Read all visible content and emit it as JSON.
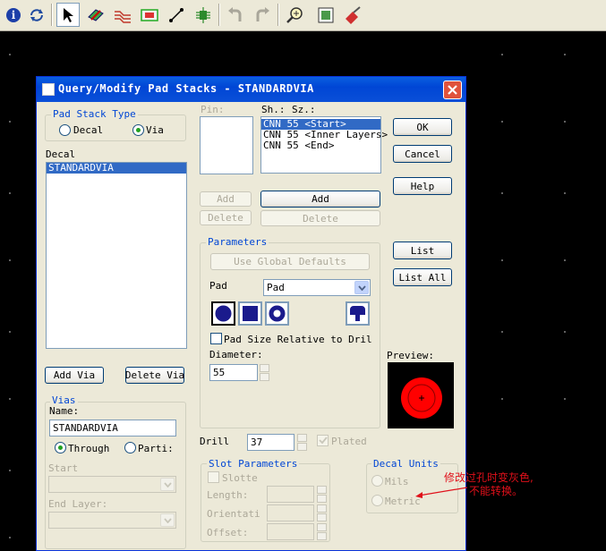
{
  "dialog": {
    "title": "Query/Modify Pad Stacks - STANDARDVIA",
    "pad_stack_type": {
      "legend": "Pad Stack Type",
      "decal": "Decal",
      "via": "Via",
      "selected": "via"
    },
    "decal_label": "Decal",
    "decal_list": [
      "STANDARDVIA"
    ],
    "pin_label": "Pin:",
    "sh_label": "Sh.:",
    "sz_label": "Sz.:",
    "shape_list": [
      "CNN 55 <Start>",
      "CNN 55 <Inner Layers>",
      "CNN 55 <End>"
    ],
    "ok": "OK",
    "cancel": "Cancel",
    "help": "Help",
    "list": "List",
    "list_all": "List All",
    "pin_add": "Add",
    "pin_delete": "Delete",
    "shape_add": "Add",
    "shape_delete": "Delete",
    "parameters": {
      "legend": "Parameters",
      "use_global": "Use Global Defaults",
      "pad_label": "Pad",
      "pad_value": "Pad",
      "pad_size_relative": "Pad Size Relative to Drill S",
      "diameter_label": "Diameter:",
      "diameter_value": "55"
    },
    "preview_label": "Preview:",
    "add_via": "Add Via",
    "delete_via": "Delete Via",
    "vias": {
      "legend": "Vias",
      "name_label": "Name:",
      "name_value": "STANDARDVIA",
      "through": "Through",
      "partial": "Parti:",
      "start_label": "Start",
      "end_label": "End Layer:"
    },
    "drill_label": "Drill",
    "drill_value": "37",
    "plated": "Plated",
    "slot": {
      "legend": "Slot Parameters",
      "slotted": "Slotte",
      "length": "Length:",
      "orientation": "Orientati",
      "offset": "Offset:"
    },
    "decal_units": {
      "legend": "Decal Units",
      "mils": "Mils",
      "metric": "Metric"
    }
  },
  "annotation": {
    "line1": "修改过孔时变灰色,",
    "line2": "不能转换。"
  },
  "toolbar_icons": [
    "info-icon",
    "refresh-icon",
    "select-arrow-icon",
    "layer-icon",
    "route-icon",
    "component-icon",
    "measure-icon",
    "bug-icon",
    "undo-icon",
    "redo-icon",
    "zoom-icon",
    "view-icon",
    "eraser-icon"
  ],
  "colors": {
    "title_bar": "#0046d5",
    "selection": "#316ac5",
    "pad_preview": "#ff0000",
    "note": "#e0101a"
  }
}
